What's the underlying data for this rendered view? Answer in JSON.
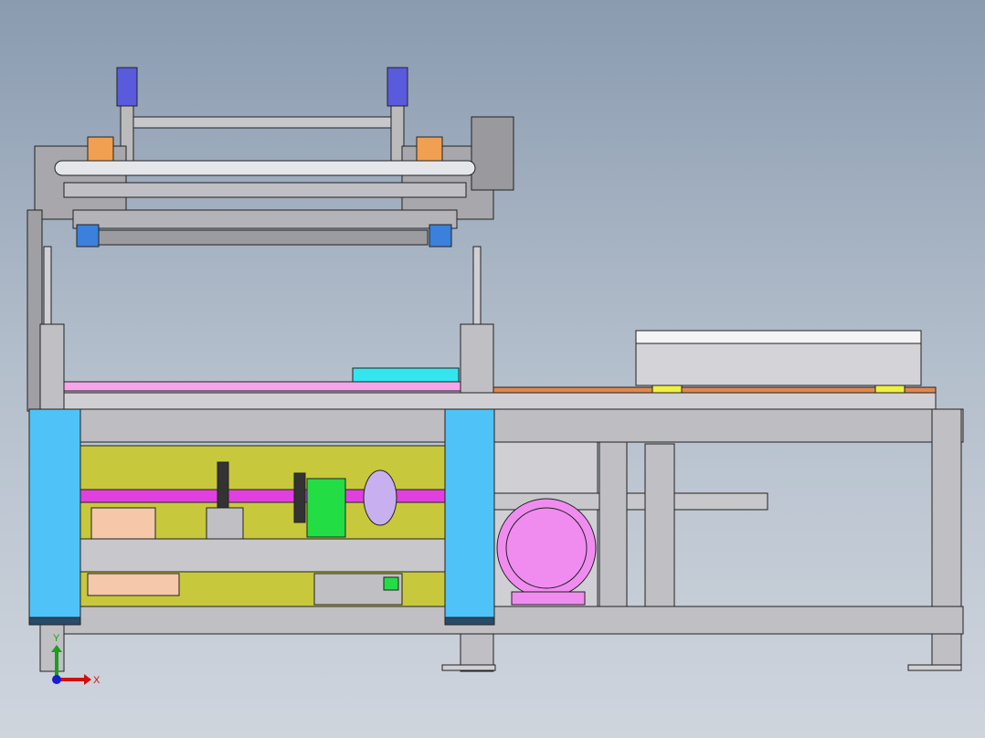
{
  "view": {
    "triad": {
      "x_label": "X",
      "y_label": "Y"
    }
  },
  "colors": {
    "frame": "#c8c8cc",
    "guard": "#4fc3f7",
    "base_plate": "#c8c83c",
    "shaft": "#e040e0",
    "motor": "#f08cf0",
    "gear_green": "#22dd44",
    "cylinder_blue": "#5a5adc",
    "cyan_block": "#33e6ee",
    "pink_rail": "#f4a6e8",
    "yellow_tab": "#f0f040"
  }
}
